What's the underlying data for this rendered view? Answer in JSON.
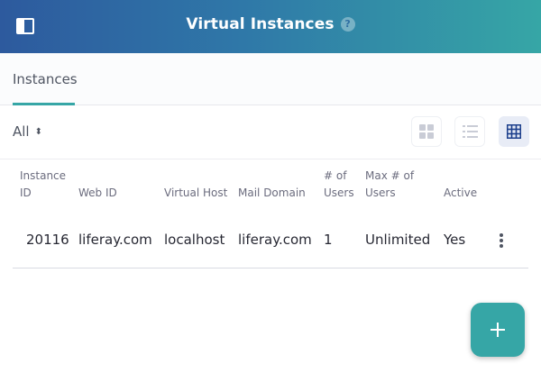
{
  "header": {
    "title": "Virtual Instances",
    "help_icon": "?",
    "colors": {
      "gradient_start": "#2d5a9e",
      "gradient_end": "#36a6a6"
    }
  },
  "tabs": [
    {
      "label": "Instances",
      "active": true
    }
  ],
  "toolbar": {
    "filter_label": "All",
    "view_modes": [
      {
        "name": "cards-view-icon",
        "active": false
      },
      {
        "name": "list-view-icon",
        "active": false
      },
      {
        "name": "table-view-icon",
        "active": true
      }
    ]
  },
  "table": {
    "columns": [
      {
        "line1": "Instance",
        "line2": "ID"
      },
      {
        "line1": "",
        "line2": "Web ID"
      },
      {
        "line1": "",
        "line2": "Virtual Host"
      },
      {
        "line1": "",
        "line2": "Mail Domain"
      },
      {
        "line1": "# of",
        "line2": "Users"
      },
      {
        "line1": "Max # of",
        "line2": "Users"
      },
      {
        "line1": "",
        "line2": "Active"
      }
    ],
    "rows": [
      {
        "instance_id": "20116",
        "web_id": "liferay.com",
        "virtual_host": "localhost",
        "mail_domain": "liferay.com",
        "users": "1",
        "max_users": "Unlimited",
        "active": "Yes"
      }
    ]
  },
  "fab": {
    "icon": "plus-icon",
    "color": "#36a6a6"
  }
}
